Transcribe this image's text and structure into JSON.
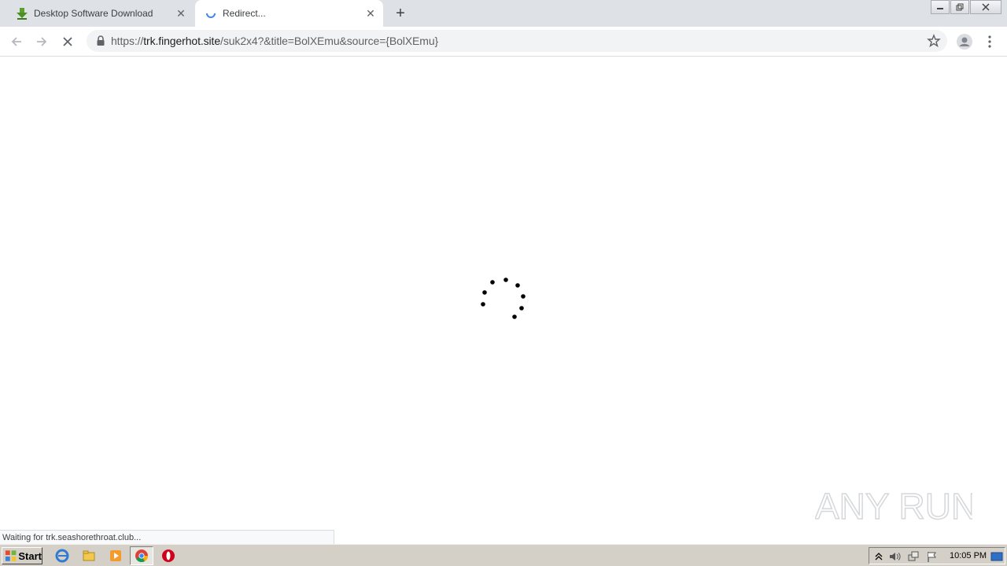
{
  "tabs": [
    {
      "title": "Desktop Software Download",
      "state": "inactive",
      "icon": "download-arrow-icon"
    },
    {
      "title": "Redirect...",
      "state": "active",
      "icon": "loading-spinner-icon"
    }
  ],
  "window_controls": [
    "minimize",
    "restore",
    "close"
  ],
  "toolbar": {
    "url_scheme": "https://",
    "url_host": "trk.fingerhot.site",
    "url_path": "/suk2x4?&title=BolXEmu&source={BolXEmu}"
  },
  "status": {
    "text": "Waiting for trk.seashorethroat.club..."
  },
  "watermark": {
    "text": "ANY RUN"
  },
  "taskbar": {
    "start_label": "Start",
    "clock": "10:05 PM"
  },
  "colors": {
    "tabstrip": "#dee1e6",
    "omnibox": "#f1f3f4",
    "taskbar": "#d4d0c8",
    "spinner": "#000000"
  }
}
